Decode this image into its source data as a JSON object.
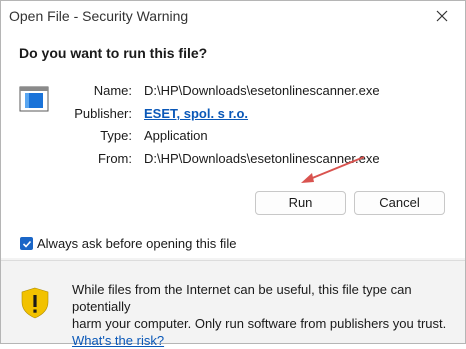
{
  "window": {
    "title": "Open File - Security Warning"
  },
  "dialog": {
    "question": "Do you want to run this file?",
    "details": [
      {
        "label": "Name:",
        "value": "D:\\HP\\Downloads\\esetonlinescanner.exe"
      },
      {
        "label": "Publisher:",
        "value": "ESET, spol. s r.o."
      },
      {
        "label": "Type:",
        "value": "Application"
      },
      {
        "label": "From:",
        "value": "D:\\HP\\Downloads\\esetonlinescanner.exe"
      }
    ],
    "run_label": "Run",
    "cancel_label": "Cancel",
    "always_ask_label": "Always ask before opening this file",
    "always_ask_checked": true
  },
  "warning": {
    "line1": "While files from the Internet can be useful, this file type can potentially",
    "line2": "harm your computer. Only run software from publishers you trust.",
    "link": "What's the risk?"
  },
  "colors": {
    "accent": "#1a66c7",
    "link": "#0a58b8",
    "shield": "#f2c200",
    "annotation_arrow": "#d9534f"
  },
  "icons": [
    "close-icon",
    "application-icon",
    "check-icon",
    "shield-warning-icon"
  ]
}
